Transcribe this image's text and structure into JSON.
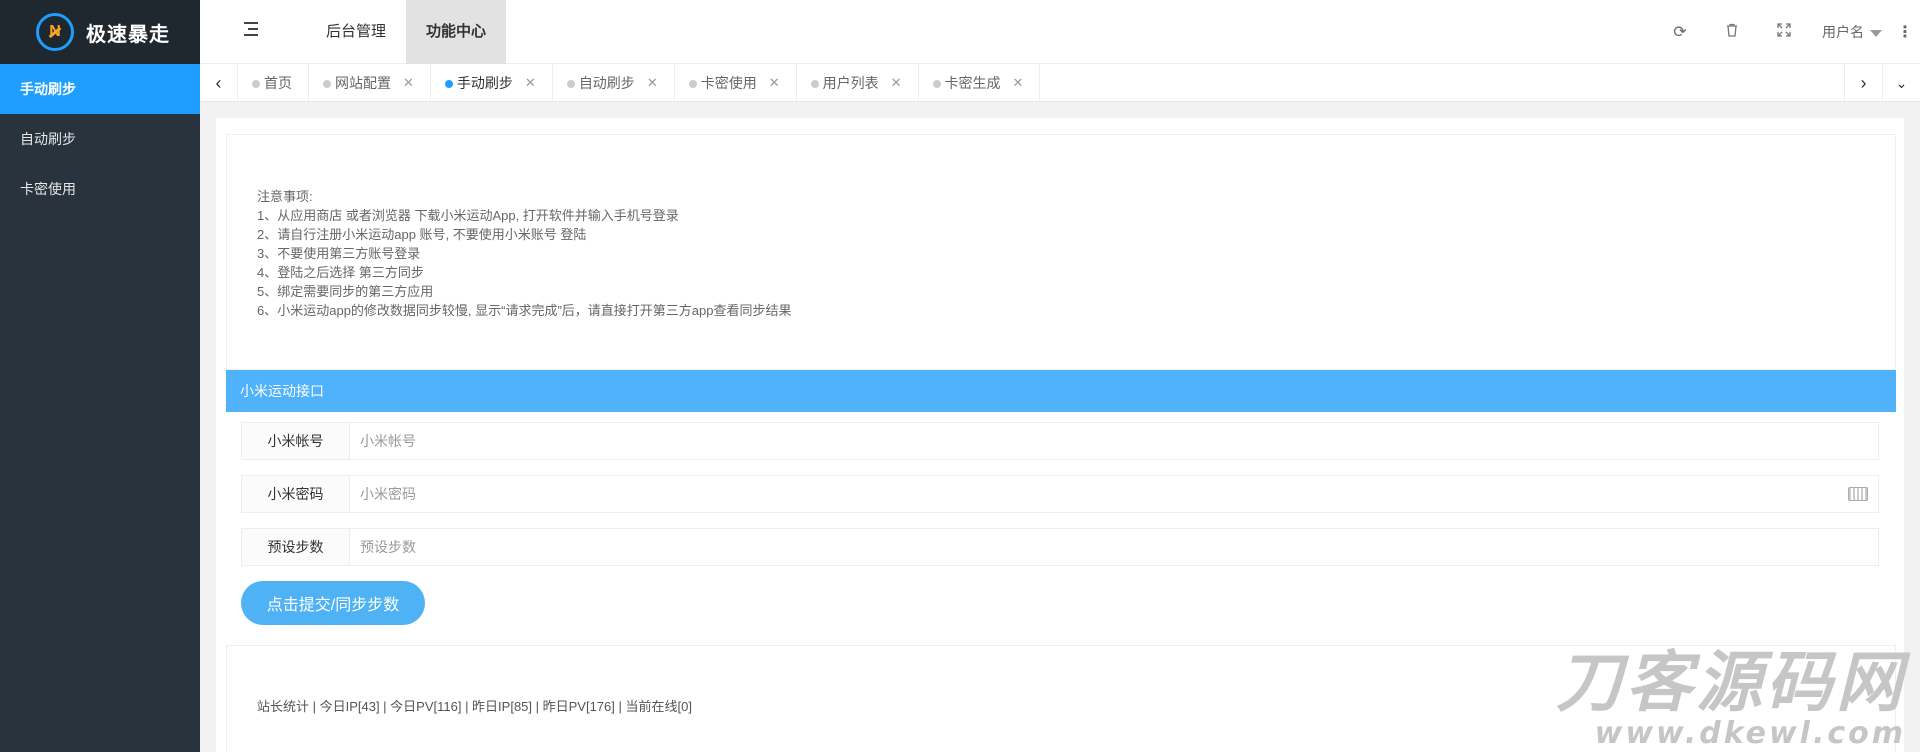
{
  "app": {
    "logo_text": "极速暴走",
    "logo_mark": "N"
  },
  "sidebar": {
    "items": [
      {
        "label": "手动刷步"
      },
      {
        "label": "自动刷步"
      },
      {
        "label": "卡密使用"
      }
    ]
  },
  "header": {
    "nav": [
      {
        "label": "后台管理"
      },
      {
        "label": "功能中心"
      }
    ],
    "icons": [
      "refresh-icon",
      "trash-icon",
      "fullscreen-icon"
    ],
    "user_label": "用户名"
  },
  "tabs": [
    {
      "label": "首页"
    },
    {
      "label": "网站配置"
    },
    {
      "label": "手动刷步"
    },
    {
      "label": "自动刷步"
    },
    {
      "label": "卡密使用"
    },
    {
      "label": "用户列表"
    },
    {
      "label": "卡密生成"
    }
  ],
  "notice": {
    "lines": [
      "注意事项:",
      "1、从应用商店 或者浏览器 下载小米运动App, 打开软件并输入手机号登录",
      "2、请自行注册小米运动app 账号, 不要使用小米账号 登陆",
      "3、不要使用第三方账号登录",
      "4、登陆之后选择 第三方同步",
      "5、绑定需要同步的第三方应用",
      "6、小米运动app的修改数据同步较慢, 显示“请求完成”后，请直接打开第三方app查看同步结果"
    ]
  },
  "form": {
    "title": "小米运动接口",
    "fields": [
      {
        "label": "小米帐号",
        "placeholder": "小米帐号"
      },
      {
        "label": "小米密码",
        "placeholder": "小米密码"
      },
      {
        "label": "预设步数",
        "placeholder": "预设步数"
      }
    ],
    "submit_label": "点击提交/同步步数"
  },
  "stats": {
    "text": "站长统计 | 今日IP[43] | 今日PV[116] | 昨日IP[85] | 昨日PV[176] | 当前在线[0]"
  },
  "watermark": {
    "big": "刀客源码网",
    "small": "www.dkewl.com"
  },
  "colors": {
    "sidebar_bg": "#28333e",
    "accent": "#1e9fff",
    "panel_head": "#50b2fa"
  }
}
